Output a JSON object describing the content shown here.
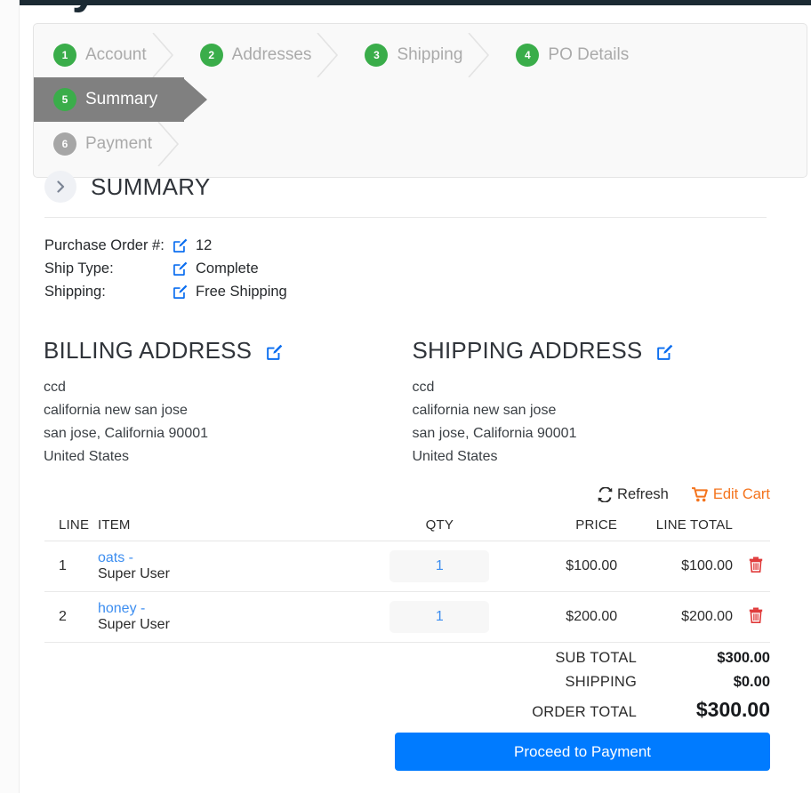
{
  "store": {
    "title": "My Awesome Store"
  },
  "wizard": {
    "steps": [
      {
        "number": "1",
        "label": "Account",
        "state": "done"
      },
      {
        "number": "2",
        "label": "Addresses",
        "state": "done"
      },
      {
        "number": "3",
        "label": "Shipping",
        "state": "done"
      },
      {
        "number": "4",
        "label": "PO Details",
        "state": "done"
      },
      {
        "number": "5",
        "label": "Summary",
        "state": "active"
      },
      {
        "number": "6",
        "label": "Payment",
        "state": "pending"
      }
    ]
  },
  "summary": {
    "heading": "SUMMARY",
    "toggle_icon": "chevron-right-icon",
    "details": [
      {
        "label": "Purchase Order #:",
        "value": "12",
        "icon": "edit-icon"
      },
      {
        "label": "Ship Type:",
        "value": "Complete",
        "icon": "edit-icon"
      },
      {
        "label": "Shipping:",
        "value": "Free Shipping",
        "icon": "edit-icon"
      }
    ]
  },
  "billing_address": {
    "title": "BILLING ADDRESS",
    "edit_icon": "edit-icon",
    "line1": "ccd",
    "line2": "california new san jose",
    "line3": "san jose, California 90001",
    "line4": "United States"
  },
  "shipping_address": {
    "title": "SHIPPING ADDRESS",
    "edit_icon": "edit-icon",
    "line1": "ccd",
    "line2": "california new san jose",
    "line3": "san jose, California 90001",
    "line4": "United States"
  },
  "cart_tools": {
    "refresh_label": "Refresh",
    "refresh_icon": "refresh-icon",
    "edit_cart_label": "Edit Cart",
    "edit_cart_icon": "shopping-cart-icon"
  },
  "cart": {
    "columns": {
      "line": "LINE",
      "item": "ITEM",
      "qty": "QTY",
      "price": "PRICE",
      "line_total": "LINE TOTAL"
    },
    "rows": [
      {
        "line": "1",
        "item_name": "oats -",
        "item_sub": "Super User",
        "qty": "1",
        "price": "$100.00",
        "line_total": "$100.00",
        "delete_icon": "trash-icon"
      },
      {
        "line": "2",
        "item_name": "honey -",
        "item_sub": "Super User",
        "qty": "1",
        "price": "$200.00",
        "line_total": "$200.00",
        "delete_icon": "trash-icon"
      }
    ]
  },
  "totals": {
    "sub_total_label": "SUB TOTAL",
    "sub_total_value": "$300.00",
    "shipping_label": "SHIPPING",
    "shipping_value": "$0.00",
    "order_total_label": "ORDER TOTAL",
    "order_total_value": "$300.00"
  },
  "actions": {
    "proceed_label": "Proceed to Payment"
  },
  "colors": {
    "step_done": "#3aad4a",
    "step_pending": "#a6a6a6",
    "step_active_bg": "#808080",
    "primary": "#007bff",
    "edit_cart": "#f4731c",
    "delete": "#e03a3a",
    "link": "#3d8ef0"
  }
}
